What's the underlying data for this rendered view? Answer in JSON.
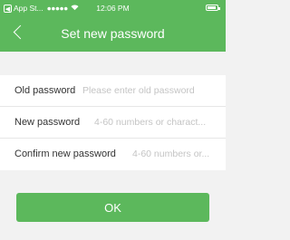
{
  "status_bar": {
    "back_app_label": "App St...",
    "signal": "●●●●●",
    "time": "12:06 PM",
    "battery_level": 0.85
  },
  "nav": {
    "title": "Set new password"
  },
  "form": {
    "fields": [
      {
        "label": "Old password",
        "placeholder": "Please enter old password"
      },
      {
        "label": "New password",
        "placeholder": "4-60 numbers or charact..."
      },
      {
        "label": "Confirm new password",
        "placeholder": "4-60 numbers or..."
      }
    ]
  },
  "ok_button": {
    "label": "OK"
  },
  "colors": {
    "accent": "#5cb85c",
    "background": "#f2f2f2"
  },
  "icons": [
    "back-arrow-icon",
    "wifi-icon",
    "battery-icon"
  ]
}
